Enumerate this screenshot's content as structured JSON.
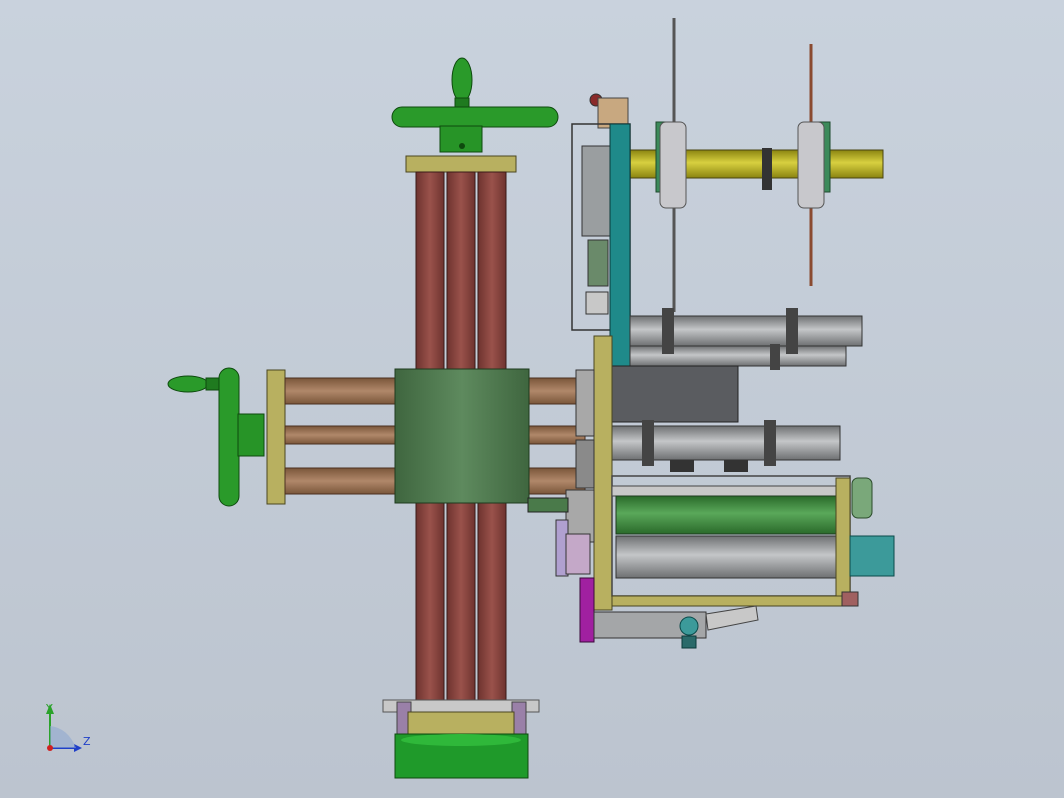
{
  "viewport": {
    "background_top": "#c9d2dd",
    "background_bottom": "#bcc4cf"
  },
  "triad": {
    "y_label": "Y",
    "z_label": "Z",
    "y_color": "#2aa22a",
    "z_color": "#1f3fc8"
  },
  "colors": {
    "handwheel": "#2a9a2a",
    "column": "#8e4a44",
    "carriage": "#4f7a4f",
    "guide_rod": "#9a7050",
    "yellow_shaft": "#c8c020",
    "teal_bar": "#1f8a8a",
    "gray_roller": "#a4a6a8",
    "green_roller": "#3c8a3c",
    "frame": "#b8b060",
    "magenta_block": "#a020a0"
  }
}
